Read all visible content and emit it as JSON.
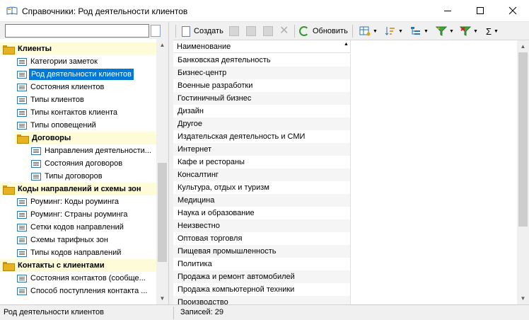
{
  "window": {
    "title": "Справочники: Род деятельности клиентов",
    "icon": "open-book-icon"
  },
  "left_panel": {
    "search": {
      "value": "",
      "placeholder": ""
    },
    "tree": [
      {
        "label": "Клиенты",
        "type": "group",
        "indent": 0
      },
      {
        "label": "Категории заметок",
        "type": "item",
        "indent": 1
      },
      {
        "label": "Род деятельности клиентов",
        "type": "item",
        "indent": 1,
        "selected": true
      },
      {
        "label": "Состояния клиентов",
        "type": "item",
        "indent": 1
      },
      {
        "label": "Типы клиентов",
        "type": "item",
        "indent": 1
      },
      {
        "label": "Типы контактов клиента",
        "type": "item",
        "indent": 1
      },
      {
        "label": "Типы оповещений",
        "type": "item",
        "indent": 1
      },
      {
        "label": "Договоры",
        "type": "group",
        "indent": 1
      },
      {
        "label": "Направления деятельности...",
        "type": "item",
        "indent": 2
      },
      {
        "label": "Состояния договоров",
        "type": "item",
        "indent": 2
      },
      {
        "label": "Типы договоров",
        "type": "item",
        "indent": 2
      },
      {
        "label": "Коды направлений и схемы зон",
        "type": "group",
        "indent": 0
      },
      {
        "label": "Роуминг: Коды роуминга",
        "type": "item",
        "indent": 1
      },
      {
        "label": "Роуминг: Страны роуминга",
        "type": "item",
        "indent": 1
      },
      {
        "label": "Сетки кодов направлений",
        "type": "item",
        "indent": 1
      },
      {
        "label": "Схемы тарифных зон",
        "type": "item",
        "indent": 1
      },
      {
        "label": "Типы кодов направлений",
        "type": "item",
        "indent": 1
      },
      {
        "label": "Контакты с клиентами",
        "type": "group",
        "indent": 0
      },
      {
        "label": "Состояния контактов (сообще...",
        "type": "item",
        "indent": 1
      },
      {
        "label": "Способ поступления контакта ...",
        "type": "item",
        "indent": 1
      }
    ]
  },
  "toolbar": {
    "create_label": "Создать",
    "refresh_label": "Обновить"
  },
  "grid": {
    "column_header": "Наименование",
    "rows": [
      "Банковская деятельность",
      "Бизнес-центр",
      "Военные разработки",
      "Гостиничный бизнес",
      "Дизайн",
      "Другое",
      "Издательская деятельность и СМИ",
      "Интернет",
      "Кафе и рестораны",
      "Консалтинг",
      "Культура, отдых и туризм",
      "Медицина",
      "Наука и образование",
      "Неизвестно",
      "Оптовая торговля",
      "Пищевая промышленность",
      "Политика",
      "Продажа и ремонт автомобилей",
      "Продажа компьютерной техники",
      "Производство"
    ]
  },
  "status": {
    "left": "Род деятельности клиентов",
    "right": "Записей: 29"
  },
  "colors": {
    "selection": "#0078d7",
    "group_bg": "#fdfbd8",
    "folder": "#e6b221"
  }
}
